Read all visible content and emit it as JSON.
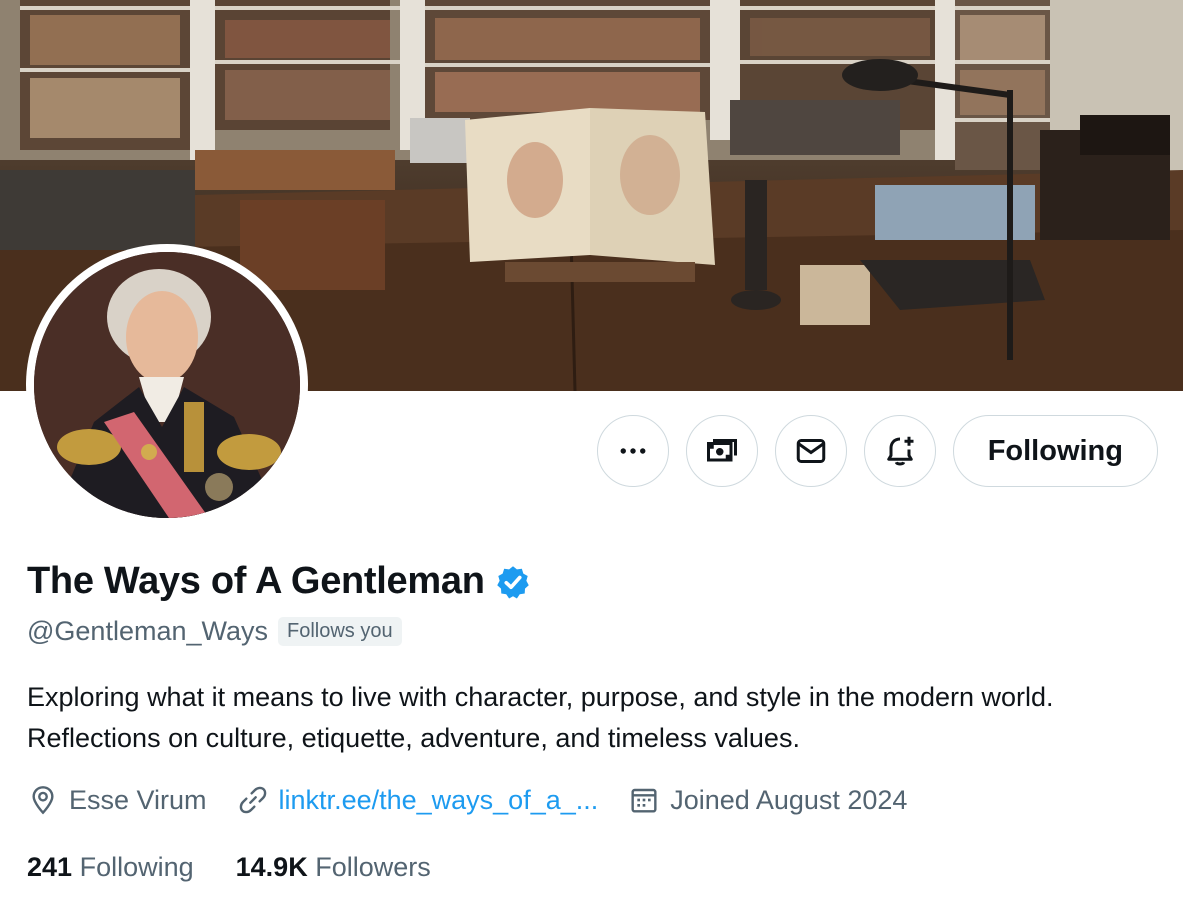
{
  "profile": {
    "display_name": "The Ways of A Gentleman",
    "verified": true,
    "handle": "@Gentleman_Ways",
    "follows_you_badge": "Follows you",
    "bio": "Exploring what it means to live with character, purpose, and style in the modern world. Reflections on culture, etiquette, adventure, and timeless values.",
    "location": "Esse Virum",
    "link": "linktr.ee/the_ways_of_a_...",
    "joined": "Joined August 2024"
  },
  "stats": {
    "following_count": "241",
    "following_label": "Following",
    "followers_count": "14.9K",
    "followers_label": "Followers"
  },
  "actions": {
    "more_icon": "more-icon",
    "subscribe_icon": "money-icon",
    "message_icon": "mail-icon",
    "notify_icon": "bell-plus-icon",
    "follow_label": "Following"
  },
  "colors": {
    "accent": "#1d9bf0",
    "text_primary": "#0f1419",
    "text_secondary": "#536471",
    "border": "#cfd9de"
  }
}
